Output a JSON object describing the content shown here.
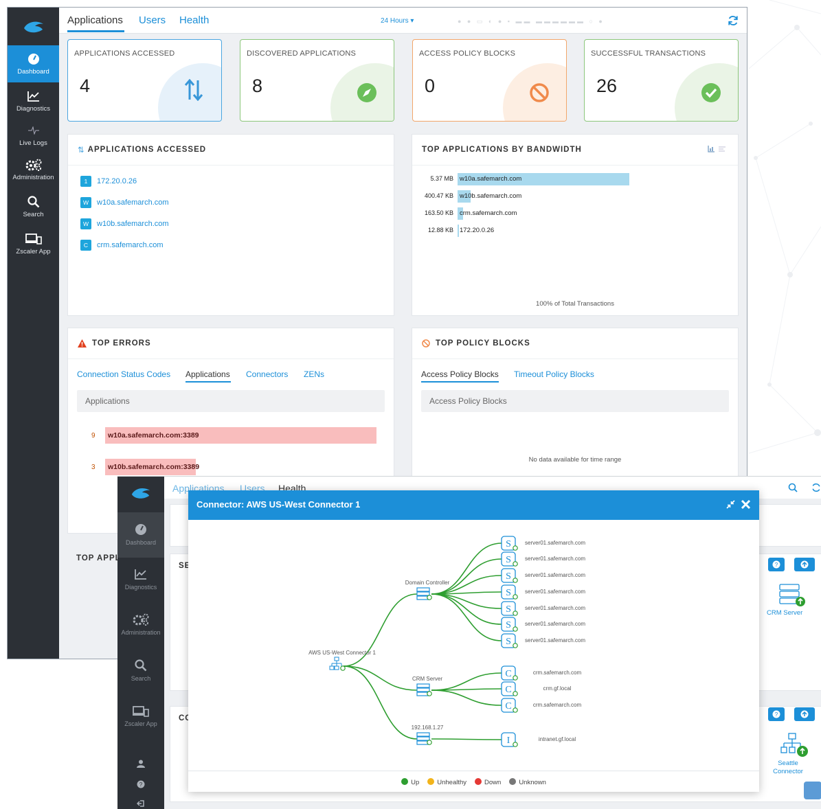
{
  "app": {
    "tabs": [
      "Applications",
      "Users",
      "Health"
    ],
    "time_range": "24 Hours"
  },
  "sidebar": {
    "items": [
      {
        "label": "Dashboard",
        "icon": "dashboard-gauge-icon"
      },
      {
        "label": "Diagnostics",
        "icon": "chart-line-icon"
      },
      {
        "label": "Live Logs",
        "icon": "pulse-icon"
      },
      {
        "label": "Administration",
        "icon": "gears-icon"
      },
      {
        "label": "Search",
        "icon": "search-icon"
      },
      {
        "label": "Zscaler App",
        "icon": "devices-icon"
      }
    ]
  },
  "kpis": [
    {
      "label": "APPLICATIONS ACCESSED",
      "value": "4",
      "color": "#4aa5e0",
      "icon": "up-down-arrows-icon"
    },
    {
      "label": "DISCOVERED APPLICATIONS",
      "value": "8",
      "color": "#8cc77b",
      "icon": "compass-icon"
    },
    {
      "label": "ACCESS POLICY BLOCKS",
      "value": "0",
      "color": "#f2a66a",
      "icon": "block-icon"
    },
    {
      "label": "SUCCESSFUL TRANSACTIONS",
      "value": "26",
      "color": "#8cc77b",
      "icon": "check-circle-icon"
    }
  ],
  "apps_accessed": {
    "title": "APPLICATIONS ACCESSED",
    "items": [
      {
        "badge": "1",
        "name": "172.20.0.26"
      },
      {
        "badge": "W",
        "name": "w10a.safemarch.com"
      },
      {
        "badge": "W",
        "name": "w10b.safemarch.com"
      },
      {
        "badge": "C",
        "name": "crm.safemarch.com"
      }
    ]
  },
  "bandwidth": {
    "title": "TOP APPLICATIONS BY BANDWIDTH",
    "footer": "100% of Total Transactions",
    "rows": [
      {
        "value": "5.37 MB",
        "name": "w10a.safemarch.com",
        "fraction": 1.0
      },
      {
        "value": "400.47 KB",
        "name": "w10b.safemarch.com",
        "fraction": 0.075
      },
      {
        "value": "163.50 KB",
        "name": "crm.safemarch.com",
        "fraction": 0.03
      },
      {
        "value": "12.88 KB",
        "name": "172.20.0.26",
        "fraction": 0.002
      }
    ]
  },
  "top_errors": {
    "title": "TOP ERRORS",
    "tabs": [
      "Connection Status Codes",
      "Applications",
      "Connectors",
      "ZENs"
    ],
    "active_tab": "Applications",
    "band": "Applications",
    "rows": [
      {
        "count": "9",
        "name": "w10a.safemarch.com:3389",
        "fraction": 1.0
      },
      {
        "count": "3",
        "name": "w10b.safemarch.com:3389",
        "fraction": 0.333
      }
    ]
  },
  "policy_blocks": {
    "title": "TOP POLICY BLOCKS",
    "tabs": [
      "Access Policy Blocks",
      "Timeout Policy Blocks"
    ],
    "band": "Access Policy Blocks",
    "empty": "No data available for time range"
  },
  "background": {
    "top_appl": "TOP APPL",
    "se": "SE",
    "co": "CO",
    "crm_server": "CRM Server",
    "seattle_connector": "Seattle Connector"
  },
  "modal": {
    "title": "Connector: AWS US-West Connector 1",
    "root": "AWS US-West Connector 1",
    "groups": [
      {
        "name": "Domain Controller",
        "leaf_letter": "S",
        "leaves": [
          "server01.safemarch.com",
          "server01.safemarch.com",
          "server01.safemarch.com",
          "server01.safemarch.com",
          "server01.safemarch.com",
          "server01.safemarch.com",
          "server01.safemarch.com"
        ]
      },
      {
        "name": "CRM Server",
        "leaf_letter": "C",
        "leaves": [
          "crm.safemarch.com",
          "crm.gf.local",
          "crm.safemarch.com"
        ]
      },
      {
        "name": "192.168.1.27",
        "leaf_letter": "I",
        "leaves": [
          "intranet.gf.local"
        ]
      }
    ],
    "legend": [
      {
        "label": "Up",
        "color": "#2e9e30"
      },
      {
        "label": "Unhealthy",
        "color": "#f2b41b"
      },
      {
        "label": "Down",
        "color": "#e53935"
      },
      {
        "label": "Unknown",
        "color": "#777777"
      }
    ]
  }
}
